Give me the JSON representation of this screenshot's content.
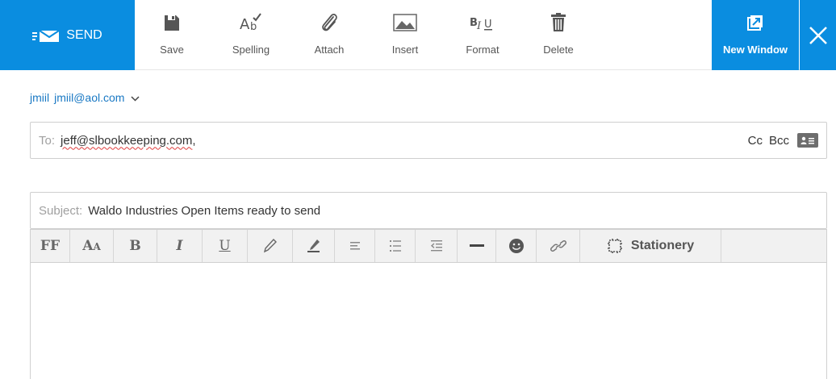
{
  "toolbar": {
    "send_label": "SEND",
    "tools": [
      {
        "label": "Save",
        "icon": "save-icon"
      },
      {
        "label": "Spelling",
        "icon": "spelling-icon"
      },
      {
        "label": "Attach",
        "icon": "paperclip-icon"
      },
      {
        "label": "Insert",
        "icon": "image-icon"
      },
      {
        "label": "Format",
        "icon": "format-icon"
      },
      {
        "label": "Delete",
        "icon": "trash-icon"
      }
    ],
    "new_window_label": "New Window",
    "accent": "#0a8de0"
  },
  "from": {
    "name": "jmiil",
    "email": "jmiil@aol.com"
  },
  "to": {
    "label": "To:",
    "value": "jeff@slbookkeeping.com",
    "separator": ",",
    "cc_label": "Cc",
    "bcc_label": "Bcc"
  },
  "subject": {
    "label": "Subject:",
    "value": "Waldo Industries Open Items ready to send"
  },
  "format_toolbar": {
    "font_family_label": "FF",
    "font_size_label": "AA",
    "bold_label": "B",
    "italic_label": "I",
    "underline_label": "U",
    "stationery_label": "Stationery"
  }
}
